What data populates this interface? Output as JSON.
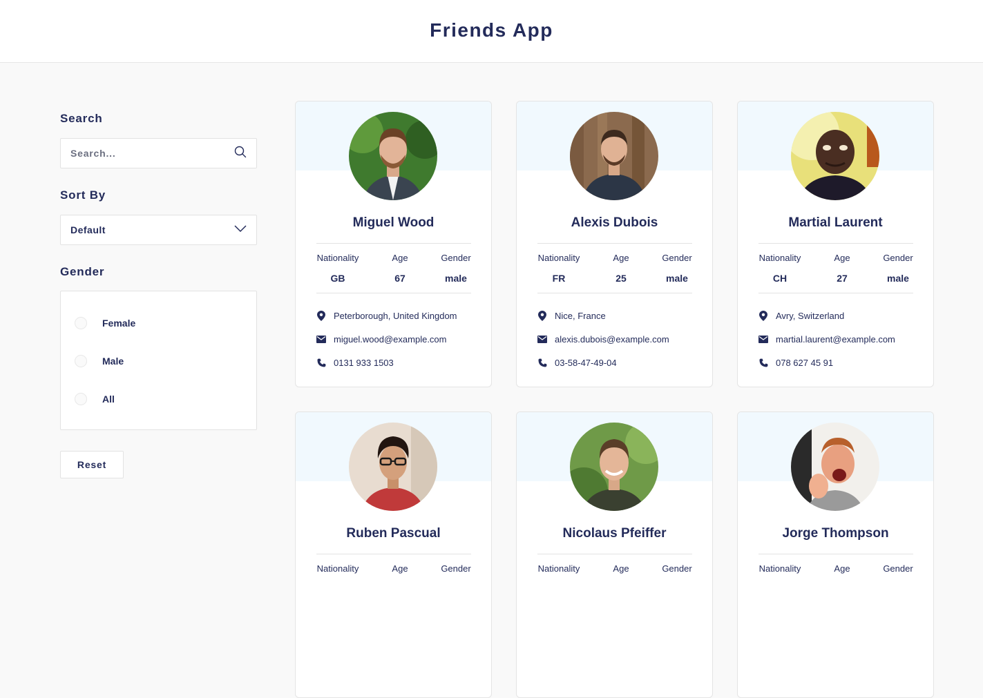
{
  "header": {
    "title": "Friends App"
  },
  "sidebar": {
    "search_label": "Search",
    "search_placeholder": "Search...",
    "sort_label": "Sort By",
    "sort_value": "Default",
    "gender_label": "Gender",
    "gender_options": [
      "Female",
      "Male",
      "All"
    ],
    "reset_label": "Reset"
  },
  "labels": {
    "nationality": "Nationality",
    "age": "Age",
    "gender": "Gender"
  },
  "cards": [
    {
      "name": "Miguel Wood",
      "nationality": "GB",
      "age": "67",
      "gender": "male",
      "location": "Peterborough, United Kingdom",
      "email": "miguel.wood@example.com",
      "phone": "0131 933 1503"
    },
    {
      "name": "Alexis Dubois",
      "nationality": "FR",
      "age": "25",
      "gender": "male",
      "location": "Nice, France",
      "email": "alexis.dubois@example.com",
      "phone": "03-58-47-49-04"
    },
    {
      "name": "Martial Laurent",
      "nationality": "CH",
      "age": "27",
      "gender": "male",
      "location": "Avry, Switzerland",
      "email": "martial.laurent@example.com",
      "phone": "078 627 45 91"
    },
    {
      "name": "Ruben Pascual"
    },
    {
      "name": "Nicolaus Pfeiffer"
    },
    {
      "name": "Jorge Thompson"
    }
  ],
  "colors": {
    "text": "#232b5a",
    "card_header": "#f1f9fe",
    "background": "#f9f9f9"
  }
}
